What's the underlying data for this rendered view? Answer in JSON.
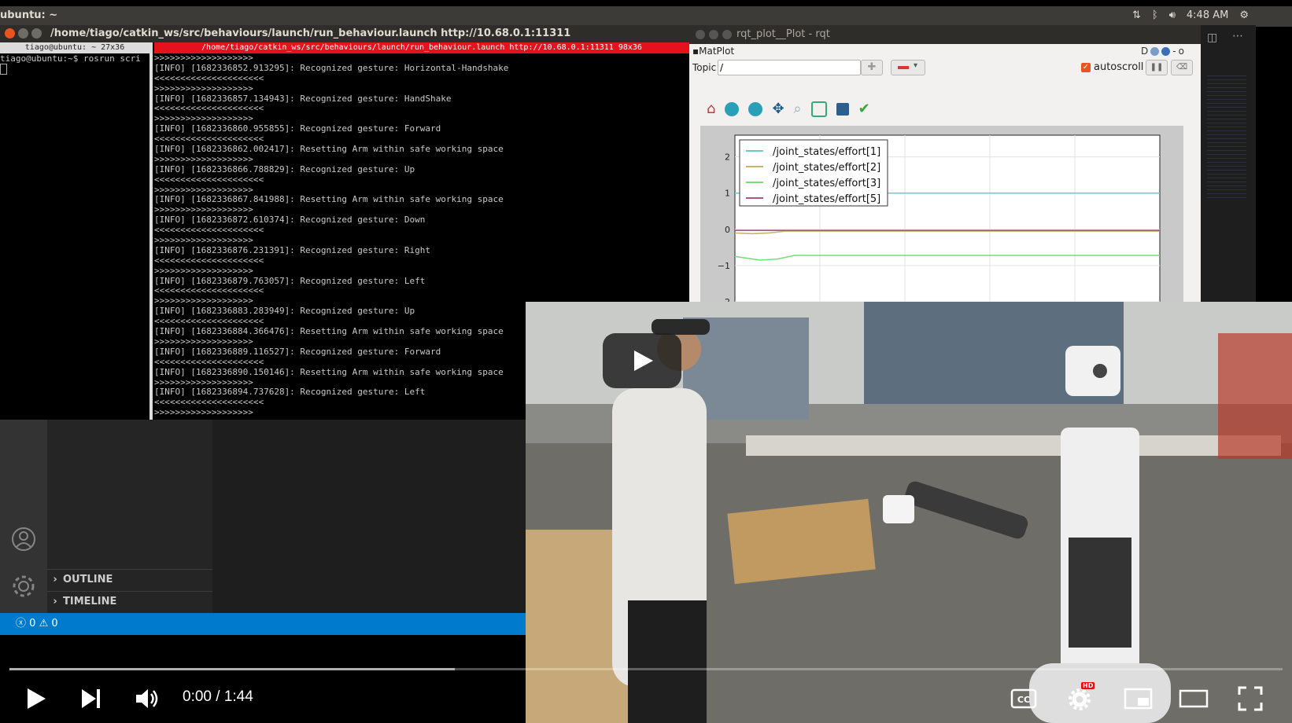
{
  "topbar": {
    "title": "ubuntu: ~",
    "time": "4:48 AM"
  },
  "terminal": {
    "title": "/home/tiago/catkin_ws/src/behaviours/launch/run_behaviour.launch http://10.68.0.1:11311",
    "tab1": "tiago@ubuntu: ~ 27x36",
    "tab2": "/home/tiago/catkin_ws/src/behaviours/launch/run_behaviour.launch http://10.68.0.1:11311 98x36",
    "left_prompt": "tiago@ubuntu:~$ rosrun scri",
    "log_lines": [
      ">>>>>>>>>>>>>>>>>>>",
      "[INFO] [1682336852.913295]: Recognized gesture: Horizontal-Handshake",
      "<<<<<<<<<<<<<<<<<<<<<",
      ">>>>>>>>>>>>>>>>>>>",
      "[INFO] [1682336857.134943]: Recognized gesture: HandShake",
      "<<<<<<<<<<<<<<<<<<<<<",
      ">>>>>>>>>>>>>>>>>>>",
      "[INFO] [1682336860.955855]: Recognized gesture: Forward",
      "<<<<<<<<<<<<<<<<<<<<<",
      "[INFO] [1682336862.002417]: Resetting Arm within safe working space",
      ">>>>>>>>>>>>>>>>>>>",
      "[INFO] [1682336866.788829]: Recognized gesture: Up",
      "<<<<<<<<<<<<<<<<<<<<<",
      ">>>>>>>>>>>>>>>>>>>",
      "[INFO] [1682336867.841988]: Resetting Arm within safe working space",
      ">>>>>>>>>>>>>>>>>>>",
      "[INFO] [1682336872.610374]: Recognized gesture: Down",
      "<<<<<<<<<<<<<<<<<<<<<",
      ">>>>>>>>>>>>>>>>>>>",
      "[INFO] [1682336876.231391]: Recognized gesture: Right",
      "<<<<<<<<<<<<<<<<<<<<<",
      ">>>>>>>>>>>>>>>>>>>",
      "[INFO] [1682336879.763057]: Recognized gesture: Left",
      "<<<<<<<<<<<<<<<<<<<<<",
      ">>>>>>>>>>>>>>>>>>>",
      "[INFO] [1682336883.283949]: Recognized gesture: Up",
      "<<<<<<<<<<<<<<<<<<<<<",
      "[INFO] [1682336884.366476]: Resetting Arm within safe working space",
      ">>>>>>>>>>>>>>>>>>>",
      "[INFO] [1682336889.116527]: Recognized gesture: Forward",
      "<<<<<<<<<<<<<<<<<<<<<",
      "[INFO] [1682336890.150146]: Resetting Arm within safe working space",
      ">>>>>>>>>>>>>>>>>>>",
      "[INFO] [1682336894.737628]: Recognized gesture: Left",
      "<<<<<<<<<<<<<<<<<<<<<",
      ">>>>>>>>>>>>>>>>>>>"
    ]
  },
  "vscode": {
    "outline": "OUTLINE",
    "timeline": "TIMELINE",
    "errors": "0",
    "warnings": "0"
  },
  "rqt": {
    "title": "rqt_plot__Plot - rqt",
    "plugin": "MatPlot",
    "plugin_controls": "D",
    "topic_label": "Topic",
    "topic_value": "/",
    "autoscroll": "autoscroll",
    "autoscroll_checked": true,
    "toolbar_icons": [
      "home-icon",
      "back-icon",
      "forward-icon",
      "pan-icon",
      "zoom-icon",
      "subplots-icon",
      "save-icon",
      "edit-icon"
    ]
  },
  "chart_data": {
    "type": "line",
    "title": "",
    "xlabel": "",
    "ylabel": "",
    "ylim": [
      -2,
      2.6
    ],
    "yticks": [
      "2",
      "1",
      "0",
      "−1",
      "−2"
    ],
    "grid": true,
    "legend_position": "top-left",
    "series": [
      {
        "name": "/joint_states/effort[1]",
        "color": "#66cccc",
        "x": [
          0,
          10
        ],
        "y": [
          1.0,
          1.0
        ]
      },
      {
        "name": "/joint_states/effort[2]",
        "color": "#c8b46e",
        "x": [
          0,
          0.4,
          0.8,
          1.2,
          10
        ],
        "y": [
          -0.1,
          -0.12,
          -0.1,
          -0.05,
          -0.05
        ]
      },
      {
        "name": "/joint_states/effort[3]",
        "color": "#77dd77",
        "x": [
          0,
          0.6,
          1.0,
          1.4,
          10
        ],
        "y": [
          -0.75,
          -0.85,
          -0.82,
          -0.72,
          -0.72
        ]
      },
      {
        "name": "/joint_states/effort[5]",
        "color": "#aa5588",
        "x": [
          0,
          10
        ],
        "y": [
          -0.03,
          -0.03
        ]
      }
    ]
  },
  "player": {
    "time": "0:00 / 1:44",
    "progress_buffered": 0.35,
    "hd_badge": "HD"
  },
  "colors": {
    "youtube_red": "#ff0000",
    "vscode_blue": "#007acc",
    "terminal_red": "#e5121d"
  }
}
